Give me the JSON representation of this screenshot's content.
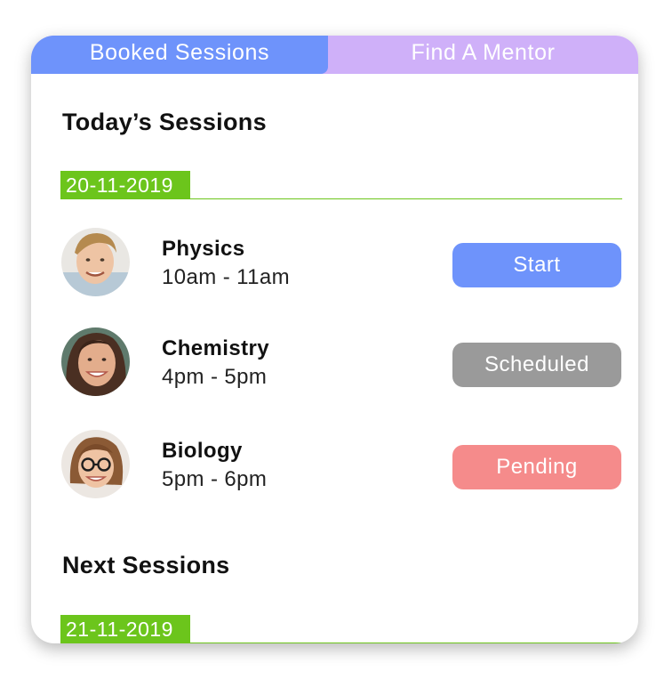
{
  "tabs": {
    "booked_label": "Booked Sessions",
    "find_label": "Find A Mentor"
  },
  "today": {
    "title": "Today’s Sessions",
    "date": "20-11-2019",
    "sessions": [
      {
        "subject": "Physics",
        "time": "10am - 11am",
        "status": "Start",
        "status_color": "#6e93fb",
        "avatar": "boy-avatar"
      },
      {
        "subject": "Chemistry",
        "time": "4pm - 5pm",
        "status": "Scheduled",
        "status_color": "#9a9a9a",
        "avatar": "girl-avatar"
      },
      {
        "subject": "Biology",
        "time": "5pm - 6pm",
        "status": "Pending",
        "status_color": "#f58b8b",
        "avatar": "girl-glasses-avatar"
      }
    ]
  },
  "next": {
    "title": "Next Sessions",
    "date": "21-11-2019"
  },
  "colors": {
    "tab_active": "#6e93fb",
    "tab_inactive": "#cfb0f9",
    "date_green": "#6cc51c"
  }
}
